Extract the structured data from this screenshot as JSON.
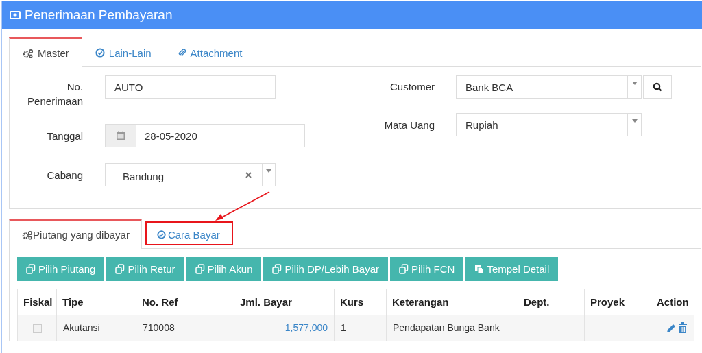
{
  "window": {
    "title": "Penerimaan Pembayaran"
  },
  "tabs": [
    {
      "label": "Master",
      "selected": true
    },
    {
      "label": "Lain-Lain",
      "selected": false
    },
    {
      "label": "Attachment",
      "selected": false
    }
  ],
  "form": {
    "left": [
      {
        "label": "No. Penerimaan",
        "kind": "text",
        "value": "AUTO"
      },
      {
        "label": "Tanggal",
        "kind": "date",
        "value": "28-05-2020"
      },
      {
        "label": "Cabang",
        "kind": "clearable",
        "value": "Bandung"
      }
    ],
    "right": [
      {
        "label": "Customer",
        "kind": "search",
        "value": "Bank BCA"
      },
      {
        "label": "Mata Uang",
        "kind": "select",
        "value": "Rupiah"
      }
    ]
  },
  "detail_tabs": [
    {
      "label": "Piutang yang dibayar",
      "selected": true,
      "highlighted": false
    },
    {
      "label": "Cara Bayar",
      "selected": false,
      "highlighted": true
    }
  ],
  "buttons": [
    "Pilih Piutang",
    "Pilih Retur",
    "Pilih Akun",
    "Pilih DP/Lebih Bayar",
    "Pilih FCN",
    "Tempel Detail"
  ],
  "table": {
    "columns": [
      "Fiskal",
      "Tipe",
      "No. Ref",
      "Jml. Bayar",
      "Kurs",
      "Keterangan",
      "Dept.",
      "Proyek",
      "Action"
    ],
    "rows": [
      {
        "fiskal": false,
        "tipe": "Akutansi",
        "no_ref": "710008",
        "jml_bayar": "1,577,000",
        "kurs": "1",
        "keterangan": "Pendapatan Bunga Bank"
      }
    ]
  }
}
